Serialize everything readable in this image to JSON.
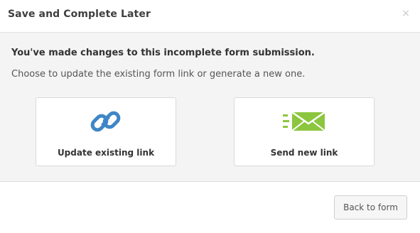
{
  "dialog": {
    "title": "Save and Complete Later",
    "close_glyph": "×"
  },
  "body": {
    "heading": "You've made changes to this incomplete form submission.",
    "subtext": "Choose to update the existing form link or generate a new one."
  },
  "options": [
    {
      "label": "Update existing link",
      "icon": "link-icon",
      "color": "#3f86c6"
    },
    {
      "label": "Send new link",
      "icon": "envelope-icon",
      "color": "#8cc63f"
    }
  ],
  "footer": {
    "back_label": "Back to form"
  }
}
